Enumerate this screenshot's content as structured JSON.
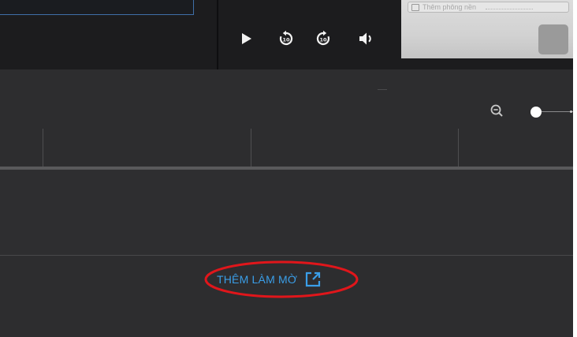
{
  "player": {
    "controls": [
      {
        "name": "play-icon",
        "label": "Play"
      },
      {
        "name": "rewind-10-icon",
        "label": "Back 10 seconds"
      },
      {
        "name": "forward-10-icon",
        "label": "Forward 10 seconds"
      },
      {
        "name": "volume-icon",
        "label": "Volume"
      }
    ],
    "rewind_badge": "10",
    "forward_badge": "10"
  },
  "preview": {
    "toolbar_text": "Thêm phông nền"
  },
  "zoom": {
    "zoom_out_icon": "zoom-out-icon",
    "slider_level": 0
  },
  "blur": {
    "more_label": "THÊM LÀM MỜ",
    "icon": "open-external-icon"
  },
  "colors": {
    "accent": "#3a9ee8",
    "annotation": "#e0161b",
    "panel": "#2d2d2f",
    "topbar": "#1c1c1e"
  }
}
